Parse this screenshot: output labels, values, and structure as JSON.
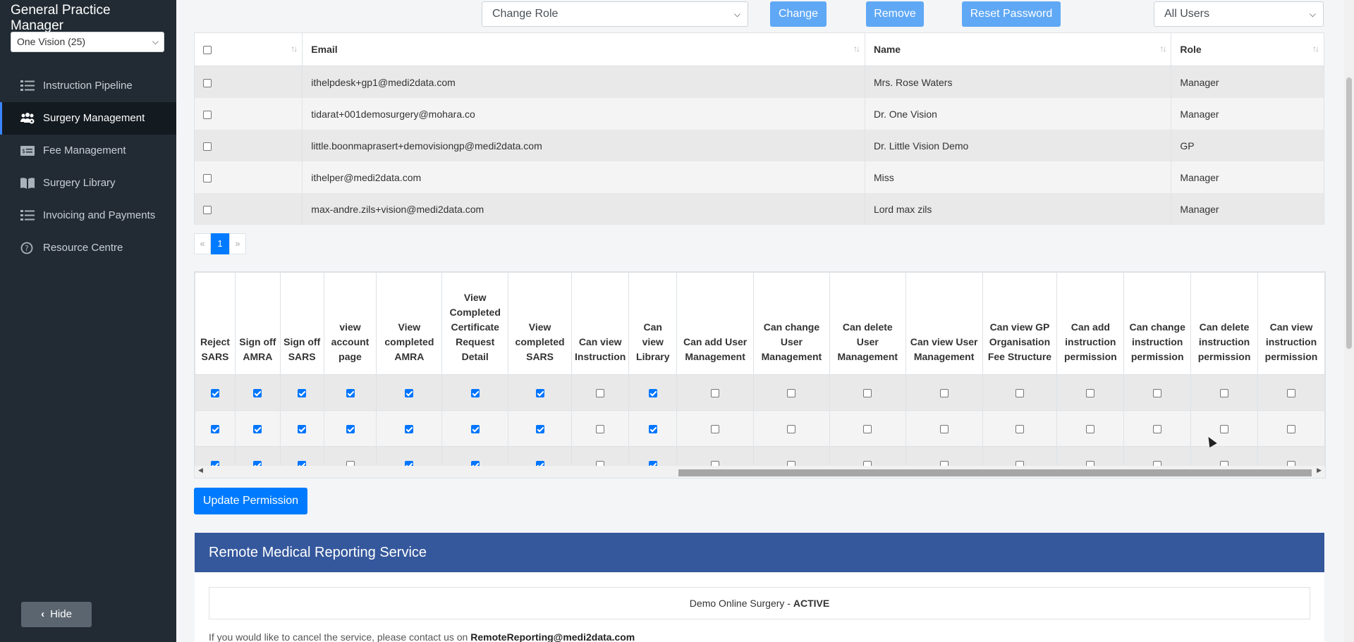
{
  "sidebar": {
    "brand": "General Practice Manager",
    "org_select": "One Vision (25)",
    "items": [
      {
        "label": "Instruction Pipeline",
        "icon": "list-check-icon"
      },
      {
        "label": "Surgery Management",
        "icon": "users-gear-icon"
      },
      {
        "label": "Fee Management",
        "icon": "money-bill-icon"
      },
      {
        "label": "Surgery Library",
        "icon": "book-open-icon"
      },
      {
        "label": "Invoicing and Payments",
        "icon": "list-check-icon"
      },
      {
        "label": "Resource Centre",
        "icon": "question-circle-icon"
      }
    ],
    "active_index": 1,
    "hide_label": "Hide"
  },
  "toolbar": {
    "role_select": "Change Role",
    "change_label": "Change",
    "remove_label": "Remove",
    "reset_label": "Reset Password",
    "filter_select": "All Users"
  },
  "users_table": {
    "headers": {
      "email": "Email",
      "name": "Name",
      "role": "Role"
    },
    "rows": [
      {
        "email": "ithelpdesk+gp1@medi2data.com",
        "name": "Mrs. Rose Waters",
        "role": "Manager"
      },
      {
        "email": "tidarat+001demosurgery@mohara.co",
        "name": "Dr. One Vision",
        "role": "Manager"
      },
      {
        "email": "little.boonmaprasert+demovisiongp@medi2data.com",
        "name": "Dr. Little Vision Demo",
        "role": "GP"
      },
      {
        "email": "ithelper@medi2data.com",
        "name": "Miss",
        "role": "Manager"
      },
      {
        "email": "max-andre.zils+vision@medi2data.com",
        "name": "Lord max zils",
        "role": "Manager"
      }
    ]
  },
  "pager": {
    "prev": "«",
    "current": "1",
    "next": "»"
  },
  "permissions": {
    "headers": [
      "Reject SARS",
      "Sign off AMRA",
      "Sign off SARS",
      "view account page",
      "View completed AMRA",
      "View Completed Certificate Request Detail",
      "View completed SARS",
      "Can view Instruction",
      "Can view Library",
      "Can add User Management",
      "Can change User Management",
      "Can delete User Management",
      "Can view User Management",
      "Can view GP Organisation Fee Structure",
      "Can add instruction permission",
      "Can change instruction permission",
      "Can delete instruction permission",
      "Can view instruction permission"
    ],
    "rows": [
      [
        true,
        true,
        true,
        true,
        true,
        true,
        true,
        false,
        true,
        false,
        false,
        false,
        false,
        false,
        false,
        false,
        false,
        false
      ],
      [
        true,
        true,
        true,
        true,
        true,
        true,
        true,
        false,
        true,
        false,
        false,
        false,
        false,
        false,
        false,
        false,
        false,
        false
      ],
      [
        true,
        true,
        true,
        false,
        true,
        true,
        true,
        false,
        true,
        false,
        false,
        false,
        false,
        false,
        false,
        false,
        false,
        false
      ]
    ]
  },
  "update_label": "Update Permission",
  "rmrs": {
    "title": "Remote Medical Reporting Service",
    "surgery": "Demo Online Surgery - ",
    "status": "ACTIVE",
    "cancel_text": "If you would like to cancel the service, please contact us on ",
    "cancel_email": "RemoteReporting@medi2data.com"
  }
}
